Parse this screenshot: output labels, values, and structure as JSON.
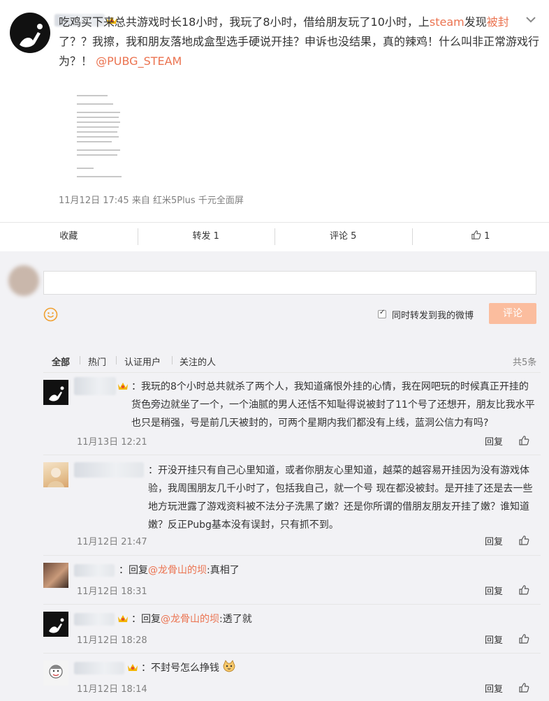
{
  "post": {
    "text_part1": "吃鸡买下来总共游戏时长18小时，我玩了8小时，借给朋友玩了10小时，上",
    "steam_link": "steam",
    "text_part2": "发现",
    "banned_word": "被封",
    "text_part3": "了？？我擦，我和朋友落地成盒型选手硬说开挂？申诉也没结果，真的辣鸡！什么叫非正常游戏行为？！",
    "mention": "@PUBG_STEAM",
    "timestamp": "11月12日 17:45",
    "source": "来自 红米5Plus 千元全面屏"
  },
  "actions": {
    "favorite": "收藏",
    "repost": "转发 1",
    "comment": "评论 5",
    "like_count": "1"
  },
  "compose": {
    "repost_checkbox_label": "同时转发到我的微博",
    "submit_label": "评论"
  },
  "filters": {
    "all": "全部",
    "hot": "热门",
    "verified": "认证用户",
    "following": "关注的人",
    "total": "共5条"
  },
  "comments": [
    {
      "text": "：我玩的8个小时总共就杀了两个人，我知道痛恨外挂的心情，我在网吧玩的时候真正开挂的货色旁边就坐了一个，一个油腻的男人还恬不知耻得说被封了11个号了还想开，朋友比我水平也只是稍强，号是前几天被封的，可两个星期内我们都没有上线，蓝洞公信力有吗?",
      "time": "11月13日 12:21",
      "reply": "回复"
    },
    {
      "text": "：开没开挂只有自己心里知道，或者你朋友心里知道，越菜的越容易开挂因为没有游戏体验，我周围朋友几千小时了，包括我自己，就一个号 现在都没被封。是开挂了还是去一些地方玩泄露了游戏资料被不法分子洗黑了嫩？还是你所谓的借朋友朋友开挂了嫩？谁知道嫩？反正Pubg基本没有误封，只有抓不到。",
      "time": "11月12日 21:47",
      "reply": "回复"
    },
    {
      "prefix": "：回复",
      "mention": "@龙骨山的坝",
      "suffix": ":真相了",
      "time": "11月12日 18:31",
      "reply": "回复"
    },
    {
      "prefix": "：回复",
      "mention": "@龙骨山的坝",
      "suffix": ":透了就",
      "time": "11月12日 18:28",
      "reply": "回复"
    },
    {
      "text": "：不封号怎么挣钱",
      "time": "11月12日 18:14",
      "reply": "回复"
    }
  ],
  "colors": {
    "accent": "#eb7350",
    "submit_disabled": "#fbbd9e",
    "grey_bg": "#f2f2f5"
  }
}
